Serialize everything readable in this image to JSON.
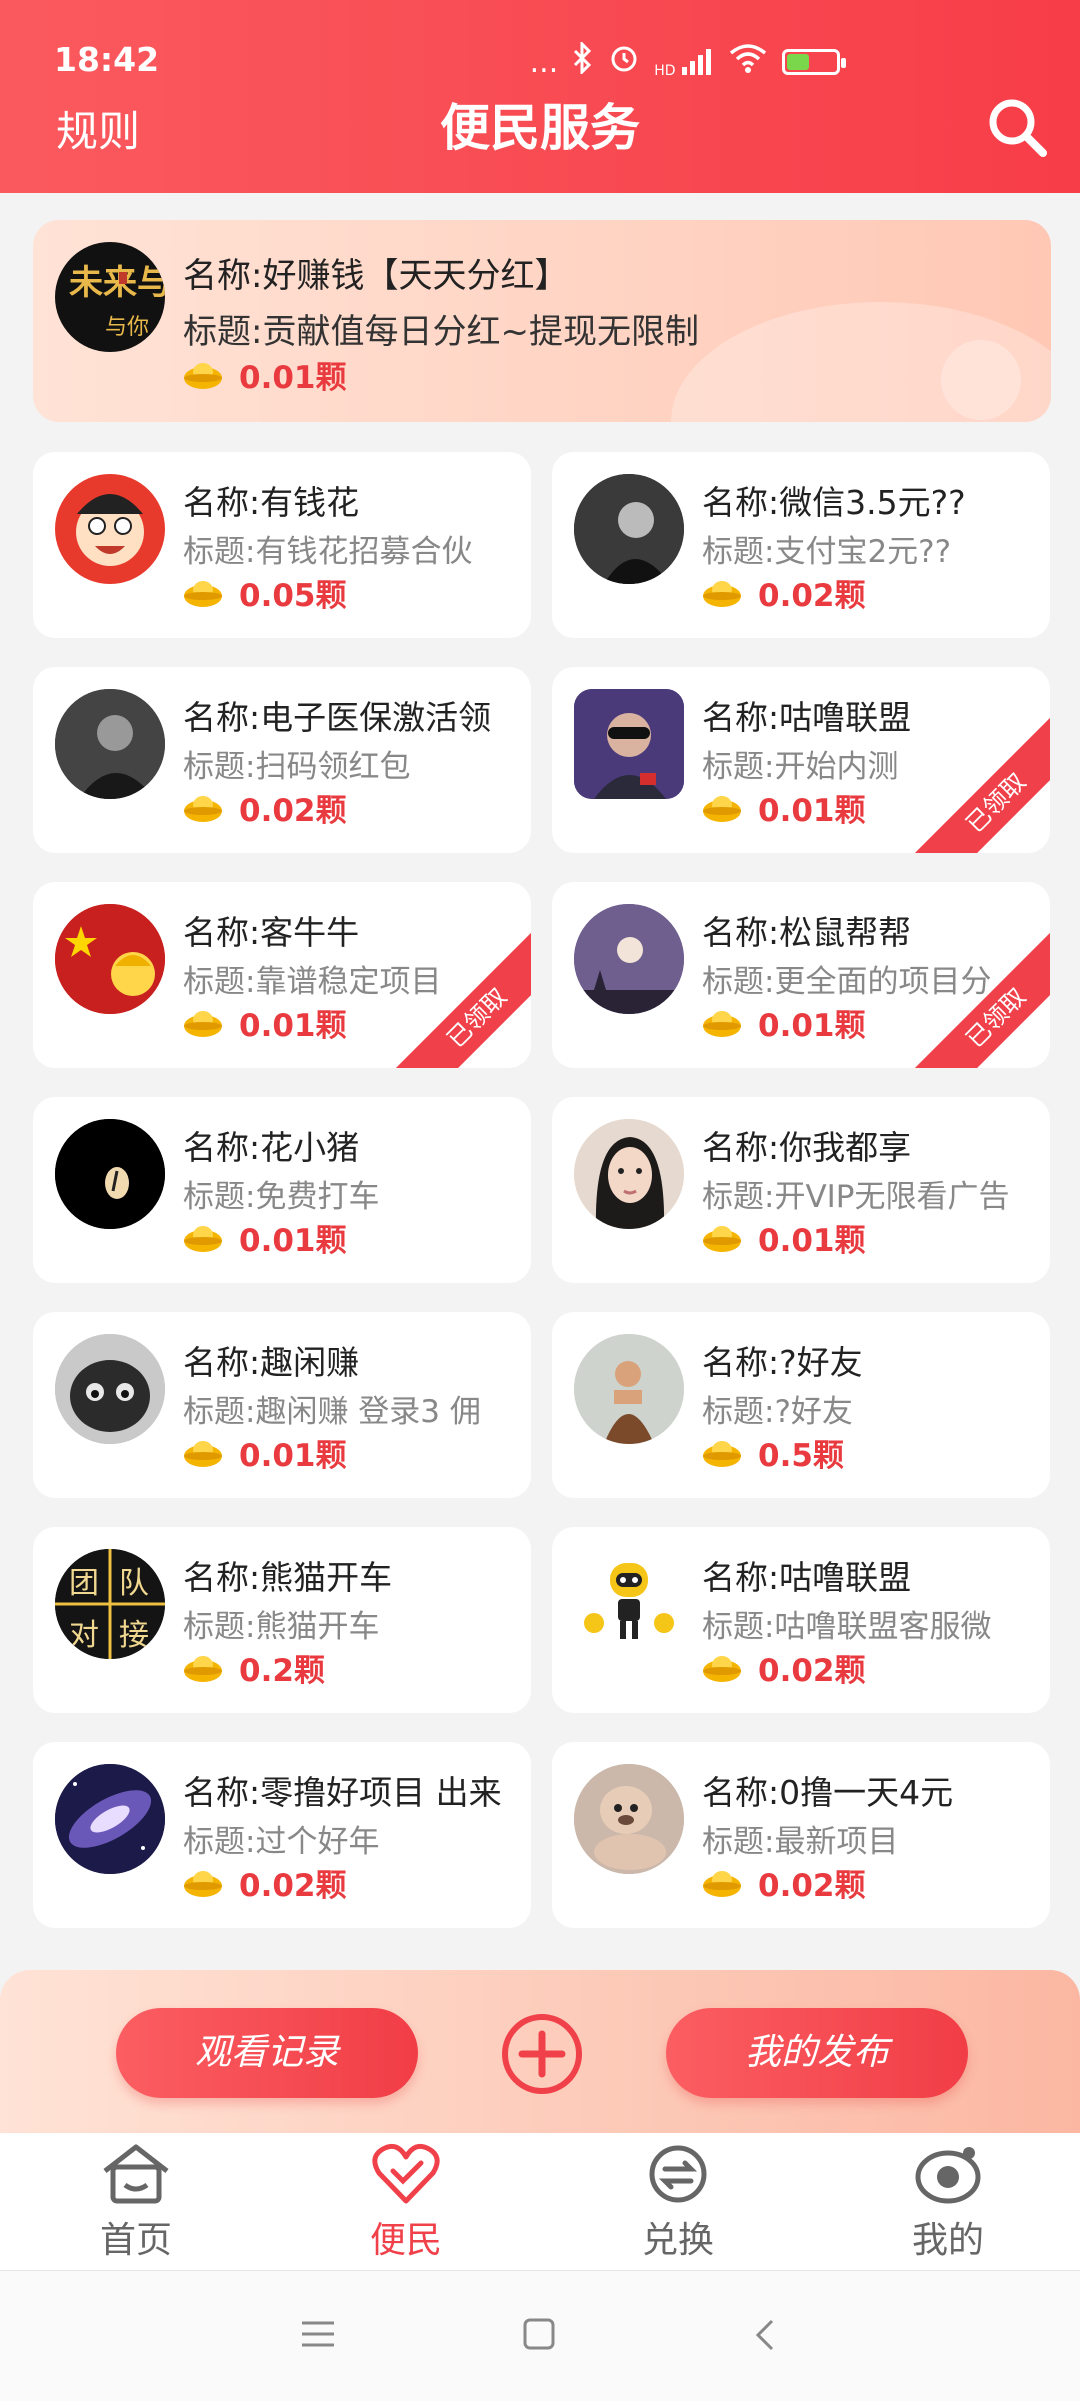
{
  "status_bar": {
    "time": "18:42",
    "dots": "...",
    "hd": "HD",
    "signal": "4G"
  },
  "header": {
    "rules_label": "规则",
    "title": "便民服务"
  },
  "featured": {
    "name": "名称:好赚钱【天天分红】",
    "subtitle": "标题:贡献值每日分红~提现无限制",
    "reward": "0.01颗",
    "avatar_text": "未来与你"
  },
  "cards": [
    {
      "name": "名称:有钱花",
      "subtitle": "标题:有钱花招募合伙",
      "reward": "0.05颗",
      "claimed": false
    },
    {
      "name": "名称:微信3.5元??",
      "subtitle": "标题:支付宝2元??",
      "reward": "0.02颗",
      "claimed": false
    },
    {
      "name": "名称:电子医保激活领",
      "subtitle": "标题:扫码领红包",
      "reward": "0.02颗",
      "claimed": false
    },
    {
      "name": "名称:咕噜联盟",
      "subtitle": "标题:开始内测",
      "reward": "0.01颗",
      "claimed": true
    },
    {
      "name": "名称:客牛牛",
      "subtitle": "标题:靠谱稳定项目",
      "reward": "0.01颗",
      "claimed": true
    },
    {
      "name": "名称:松鼠帮帮",
      "subtitle": "标题:更全面的项目分",
      "reward": "0.01颗",
      "claimed": true
    },
    {
      "name": "名称:花小猪",
      "subtitle": "标题:免费打车",
      "reward": "0.01颗",
      "claimed": false
    },
    {
      "name": "名称:你我都享",
      "subtitle": "标题:开VIP无限看广告",
      "reward": "0.01颗",
      "claimed": false
    },
    {
      "name": "名称:趣闲赚",
      "subtitle": "标题:趣闲赚 登录3 佣",
      "reward": "0.01颗",
      "claimed": false
    },
    {
      "name": "名称:?好友",
      "subtitle": "标题:?好友",
      "reward": "0.5颗",
      "claimed": false
    },
    {
      "name": "名称:熊猫开车",
      "subtitle": "标题:熊猫开车",
      "reward": "0.2颗",
      "claimed": false
    },
    {
      "name": "名称:咕噜联盟",
      "subtitle": "标题:咕噜联盟客服微",
      "reward": "0.02颗",
      "claimed": false
    },
    {
      "name": "名称:零撸好项目 出来",
      "subtitle": "标题:过个好年",
      "reward": "0.02颗",
      "claimed": false
    },
    {
      "name": "名称:0撸一天4元",
      "subtitle": "标题:最新项目",
      "reward": "0.02颗",
      "claimed": false
    }
  ],
  "ribbon_label": "已领取",
  "team_avatar": {
    "c1": "团",
    "c2": "队",
    "c3": "对",
    "c4": "接"
  },
  "actions": {
    "history_label": "观看记录",
    "publish_label": "我的发布"
  },
  "tabs": [
    {
      "label": "首页",
      "icon": "home-icon",
      "active": false
    },
    {
      "label": "便民",
      "icon": "heart-icon",
      "active": true
    },
    {
      "label": "兑换",
      "icon": "exchange-icon",
      "active": false
    },
    {
      "label": "我的",
      "icon": "profile-icon",
      "active": false
    }
  ],
  "colors": {
    "accent": "#f0414a",
    "reward": "#e83a3f",
    "gold": "#f5b400"
  }
}
